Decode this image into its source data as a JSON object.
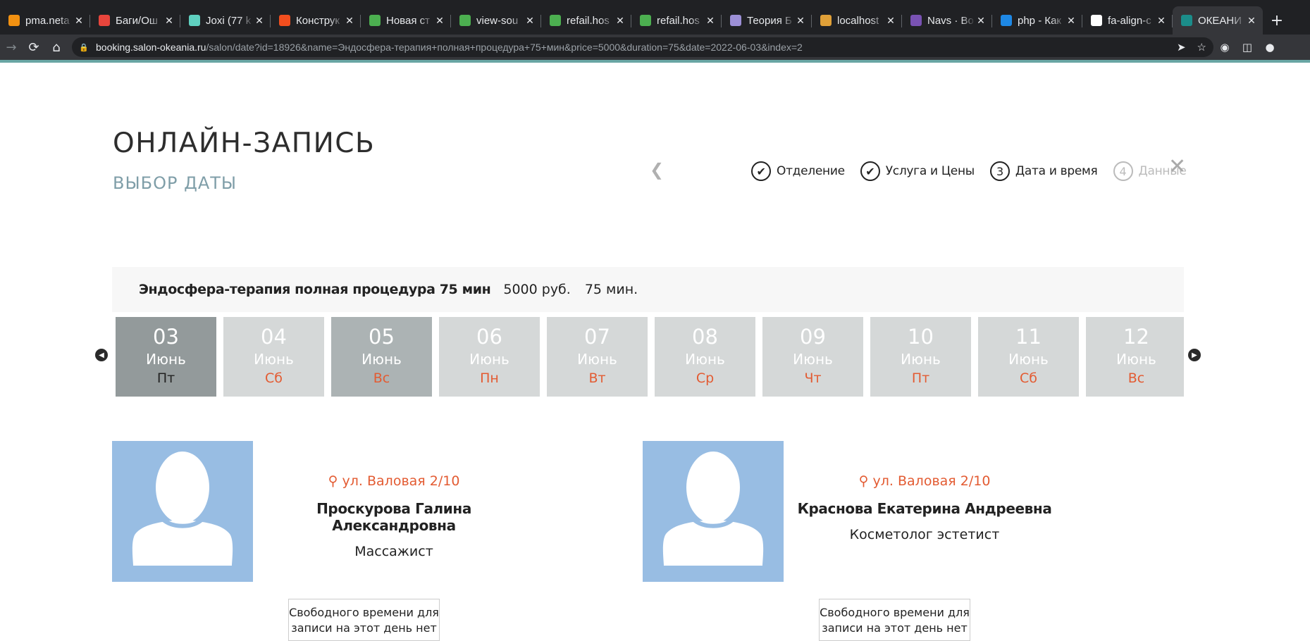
{
  "browser": {
    "tabs": [
      {
        "title": "pma.neta",
        "icon": "phpmyadmin-icon",
        "color": "#f29111"
      },
      {
        "title": "Баги/Ош",
        "icon": "bug-tracker-icon",
        "color": "#e8453c"
      },
      {
        "title": "Joxi (77 k",
        "icon": "joxi-icon",
        "color": "#5fd0c0"
      },
      {
        "title": "Конструк",
        "icon": "figma-icon",
        "color": "#f24e1e"
      },
      {
        "title": "Новая ст",
        "icon": "grid-app-icon",
        "color": "#4caf50"
      },
      {
        "title": "view-sou",
        "icon": "grid-app-icon",
        "color": "#4caf50"
      },
      {
        "title": "refail.hos",
        "icon": "grid-app-icon",
        "color": "#4caf50"
      },
      {
        "title": "refail.hos",
        "icon": "grid-app-icon",
        "color": "#4caf50"
      },
      {
        "title": "Теория Б",
        "icon": "globe-icon",
        "color": "#9c8fd6"
      },
      {
        "title": "localhost",
        "icon": "localhost-icon",
        "color": "#e0a038"
      },
      {
        "title": "Navs · Bo",
        "icon": "bootstrap-icon",
        "color": "#7952b3"
      },
      {
        "title": "php - Как",
        "icon": "stackoverflow-icon",
        "color": "#1e88e5"
      },
      {
        "title": "fa-align-c",
        "icon": "flag-icon",
        "color": "#ffffff"
      },
      {
        "title": "ОКЕАНИ",
        "icon": "okeania-icon",
        "color": "#1b8d8a",
        "active": true
      }
    ],
    "url_host": "booking.salon-okeania.ru",
    "url_path": "/salon/date?id=18926&name=Эндосфера-терапия+полная+процедура+75+мин&price=5000&duration=75&date=2022-06-03&index=2"
  },
  "header": {
    "title": "ОНЛАЙН-ЗАПИСЬ",
    "subtitle": "ВЫБОР ДАТЫ"
  },
  "steps": [
    {
      "mark": "✔",
      "label": "Отделение",
      "state": "done"
    },
    {
      "mark": "✔",
      "label": "Услуга и Цены",
      "state": "done"
    },
    {
      "mark": "3",
      "label": "Дата и время",
      "state": "current"
    },
    {
      "mark": "4",
      "label": "Данные",
      "state": "disabled"
    }
  ],
  "service": {
    "name": "Эндосфера-терапия полная процедура 75 мин",
    "price": "5000 руб.",
    "duration": "75 мин."
  },
  "days": [
    {
      "num": "03",
      "month": "Июнь",
      "weekday": "Пт",
      "state": "selected"
    },
    {
      "num": "04",
      "month": "Июнь",
      "weekday": "Сб",
      "state": "normal"
    },
    {
      "num": "05",
      "month": "Июнь",
      "weekday": "Вс",
      "state": "dark"
    },
    {
      "num": "06",
      "month": "Июнь",
      "weekday": "Пн",
      "state": "normal"
    },
    {
      "num": "07",
      "month": "Июнь",
      "weekday": "Вт",
      "state": "normal"
    },
    {
      "num": "08",
      "month": "Июнь",
      "weekday": "Ср",
      "state": "normal"
    },
    {
      "num": "09",
      "month": "Июнь",
      "weekday": "Чт",
      "state": "normal"
    },
    {
      "num": "10",
      "month": "Июнь",
      "weekday": "Пт",
      "state": "normal"
    },
    {
      "num": "11",
      "month": "Июнь",
      "weekday": "Сб",
      "state": "normal"
    },
    {
      "num": "12",
      "month": "Июнь",
      "weekday": "Вс",
      "state": "normal"
    }
  ],
  "specialists": [
    {
      "address": "ул. Валовая 2/10",
      "name": "Проскурова Галина Александровна",
      "role": "Массажист",
      "no_time": "Свободного времени для записи на этот день нет"
    },
    {
      "address": "ул. Валовая 2/10",
      "name": "Краснова Екатерина Андреевна",
      "role": "Косметолог эстетист",
      "no_time": "Свободного времени для записи на этот день нет"
    }
  ],
  "colors": {
    "accent_orange": "#e35b32",
    "teal": "#69a6a4",
    "avatar_bg": "#98bde3"
  }
}
